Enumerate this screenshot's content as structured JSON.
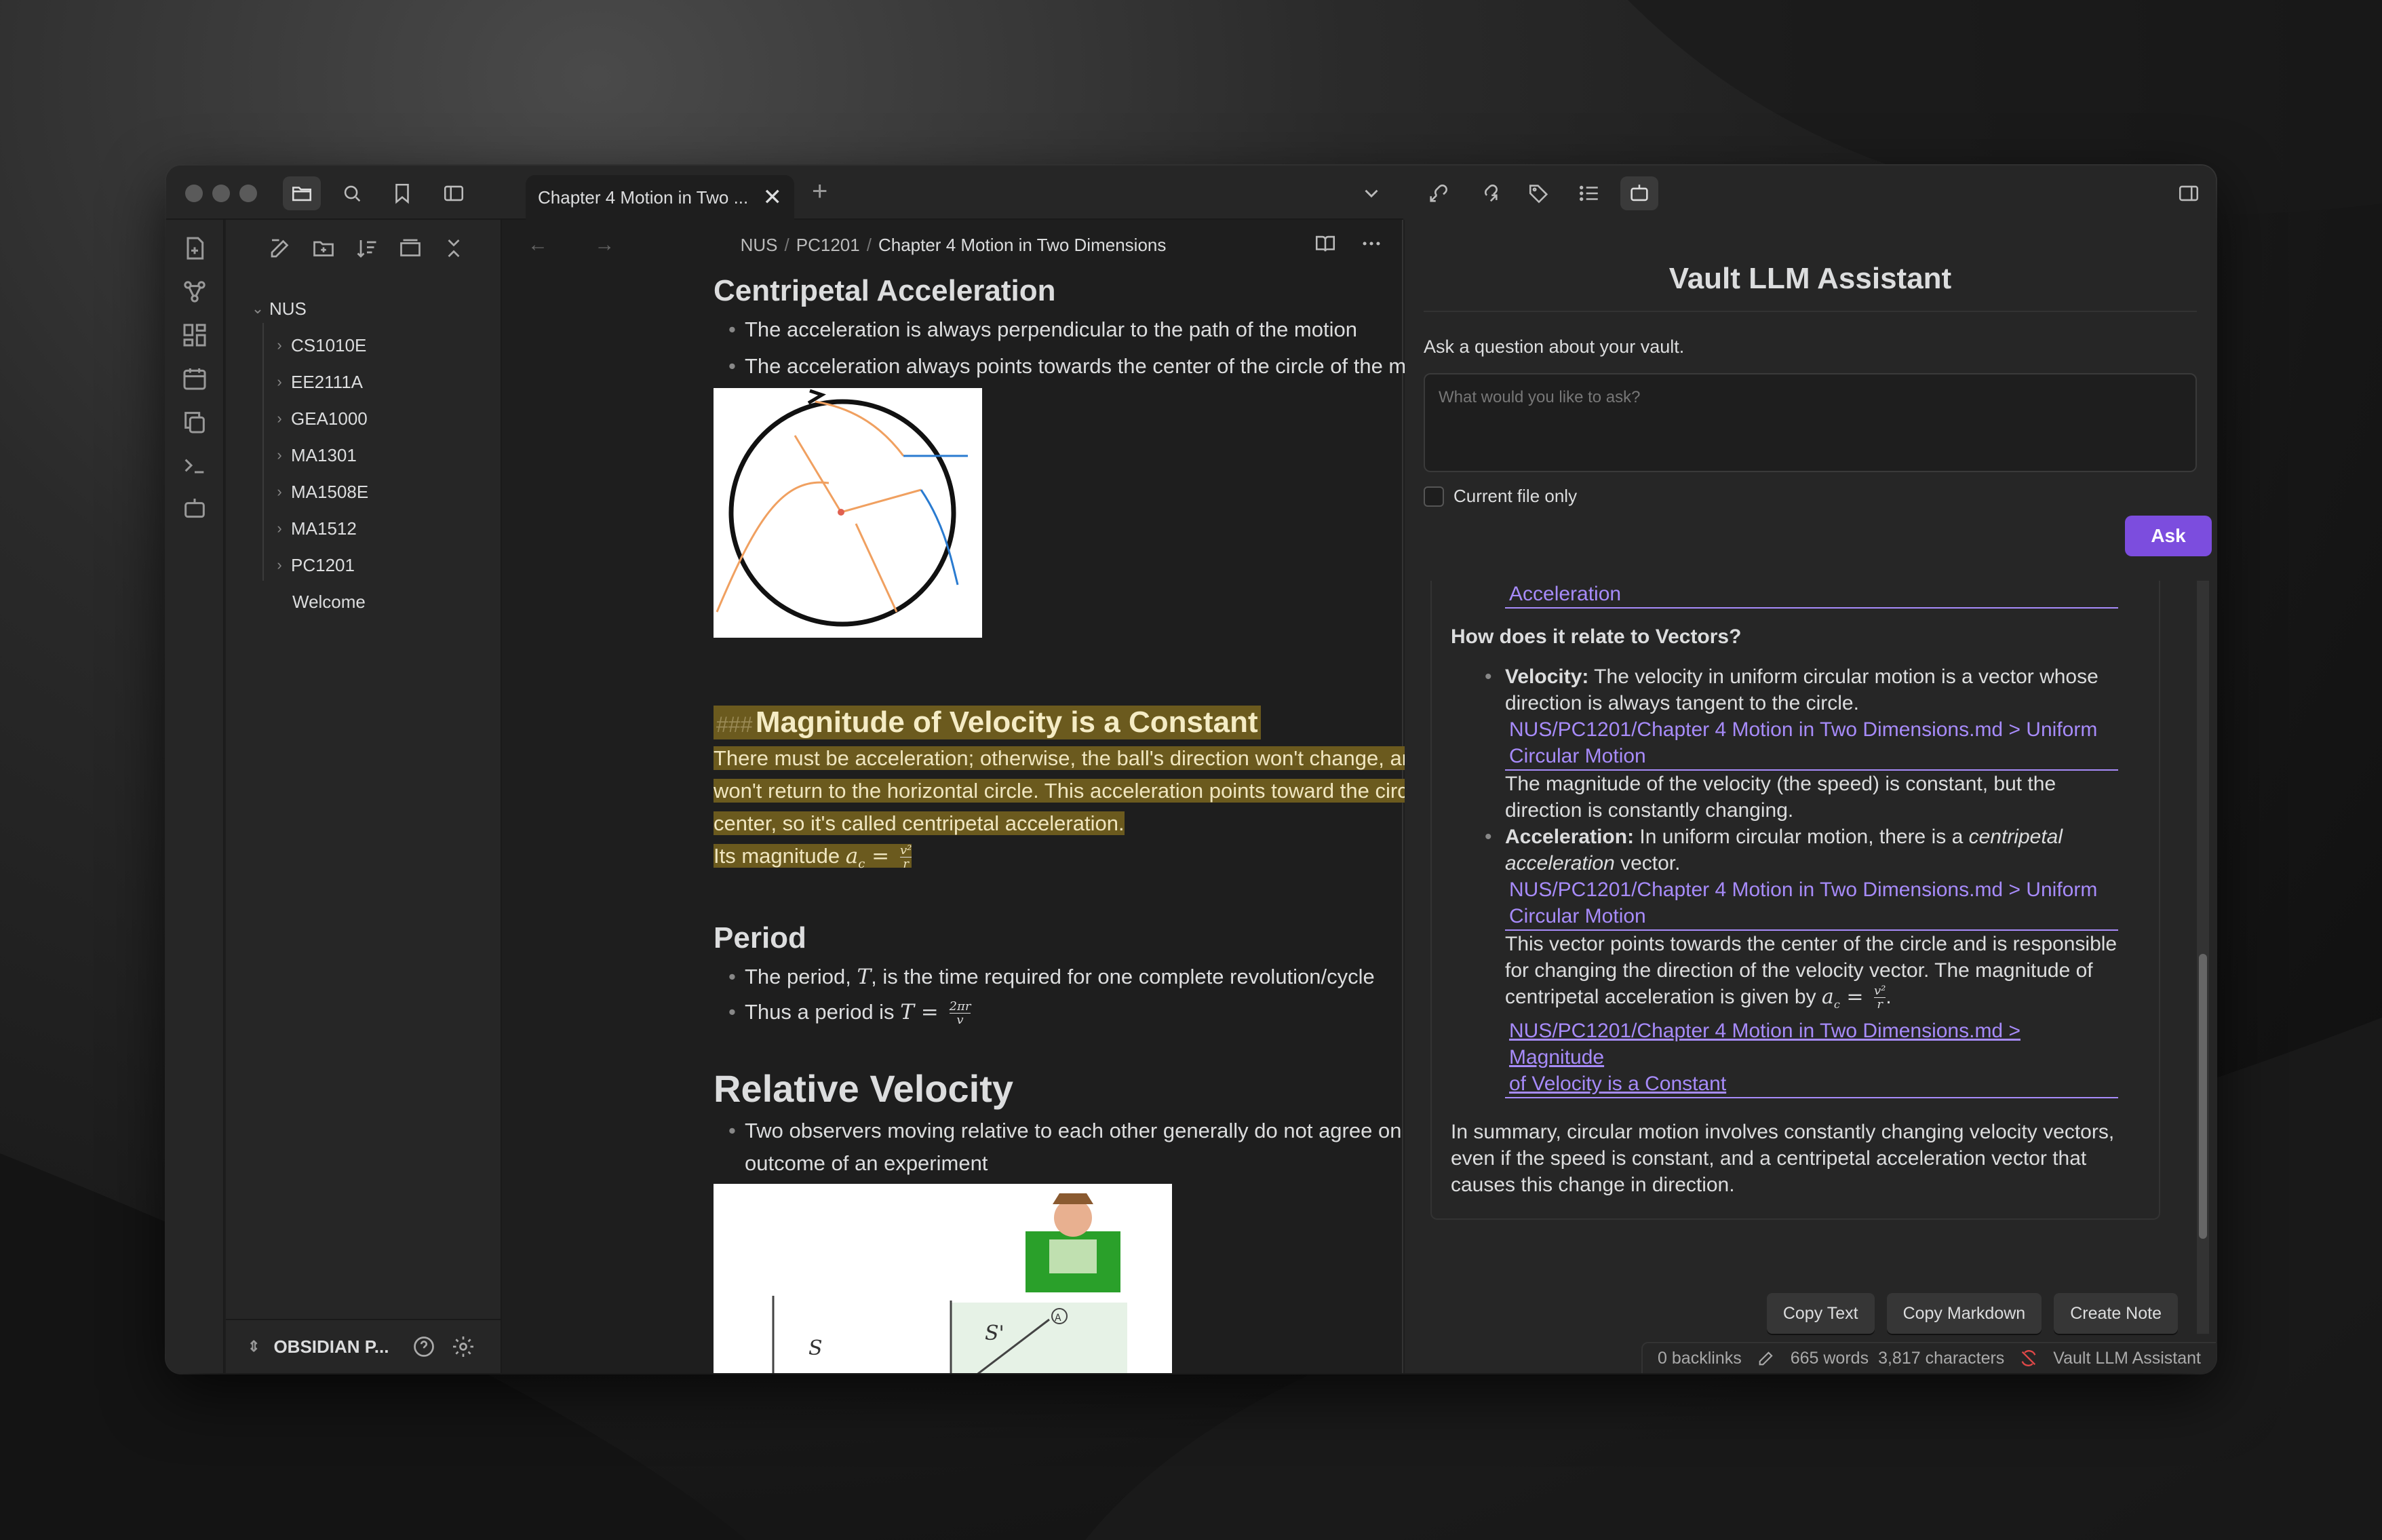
{
  "window": {
    "tab_title": "Chapter 4 Motion in Two ...",
    "tab_close": "✕",
    "new_tab": "+"
  },
  "explorer": {
    "root": "NUS",
    "folders": [
      "CS1010E",
      "EE2111A",
      "GEA1000",
      "MA1301",
      "MA1508E",
      "MA1512",
      "PC1201"
    ],
    "file": "Welcome",
    "vault_name": "OBSIDIAN P..."
  },
  "editor": {
    "nav_arrows": "← →",
    "breadcrumb": [
      "NUS",
      "PC1201",
      "Chapter 4 Motion in Two Dimensions"
    ],
    "sections": {
      "centripetal_title": "Centripetal Acceleration",
      "centripetal_bullets": [
        "The acceleration is always perpendicular to the path of the motion",
        "The acceleration always points towards the center of the circle of the motion"
      ],
      "magnitude_hash": "###",
      "magnitude_title": "Magnitude of Velocity is a Constant",
      "magnitude_para": [
        "There must be acceleration; otherwise, the ball's direction won't change, and it",
        "won't return to the horizontal circle. This acceleration points toward the circle's",
        "center, so it's called centripetal acceleration."
      ],
      "magnitude_formula_prefix": "Its magnitude",
      "magnitude_formula_lhs": "a",
      "magnitude_formula_sub": "c",
      "magnitude_formula_eq": " = ",
      "magnitude_formula_num": "v²",
      "magnitude_formula_den": "r",
      "period_title": "Period",
      "period_b1_pre": "The period,",
      "period_b1_var": "T",
      "period_b1_post": ", is the time required for one complete revolution/cycle",
      "period_b2_pre": "Thus a period is",
      "period_b2_var": "T",
      "period_b2_eq": " = ",
      "period_b2_num": "2πr",
      "period_b2_den": "v",
      "relative_title": "Relative Velocity",
      "relative_bullet": [
        "Two observers moving relative to each other generally do not agree on the",
        "outcome of an experiment"
      ],
      "figure_labels": [
        "S",
        "S'",
        "A"
      ]
    }
  },
  "assistant": {
    "title": "Vault LLM Assistant",
    "prompt": "Ask a question about your vault.",
    "placeholder": "What would you like to ask?",
    "current_file_only": "Current file only",
    "ask": "Ask",
    "answer": {
      "top_link": "Acceleration",
      "heading": "How does it relate to Vectors?",
      "velocity_label": "Velocity:",
      "velocity_text": [
        " The velocity in uniform circular motion is a vector whose",
        "direction is always tangent to the circle."
      ],
      "link_uniform_1": [
        "NUS/PC1201/Chapter 4 Motion in Two Dimensions.md > Uniform",
        "Circular Motion"
      ],
      "velocity_text2": [
        "The magnitude of the velocity (the speed) is constant, but the",
        "direction is constantly changing."
      ],
      "accel_label": "Acceleration:",
      "accel_text_pre": " In uniform circular motion, there is a ",
      "accel_text_em1": "centripetal",
      "accel_text_em2": "acceleration",
      "accel_text_post": " vector.",
      "link_uniform_2": [
        "NUS/PC1201/Chapter 4 Motion in Two Dimensions.md > Uniform",
        "Circular Motion"
      ],
      "accel_text2": [
        "This vector points towards the center of the circle and is responsible",
        "for changing the direction of the velocity vector. The magnitude of"
      ],
      "accel_text3_pre": "centripetal acceleration is given by ",
      "accel_formula_lhs": "a",
      "accel_formula_sub": "c",
      "accel_formula_eq": " = ",
      "accel_formula_num": "v²",
      "accel_formula_den": "r",
      "accel_formula_end": ".",
      "link_magnitude": [
        "NUS/PC1201/Chapter 4 Motion in Two Dimensions.md > Magnitude",
        "of Velocity is a Constant"
      ],
      "summary": [
        "In summary, circular motion involves constantly changing velocity vectors,",
        "even if the speed is constant, and a centripetal acceleration vector that",
        "causes this change in direction."
      ]
    },
    "buttons": [
      "Copy Text",
      "Copy Markdown",
      "Create Note"
    ]
  },
  "status": {
    "backlinks": "0 backlinks",
    "words": "665 words",
    "characters": "3,817 characters",
    "plugin": "Vault LLM Assistant"
  },
  "colors": {
    "accent": "#7c4dde",
    "link": "#a78bfa",
    "highlight": "#6b5a1e"
  }
}
